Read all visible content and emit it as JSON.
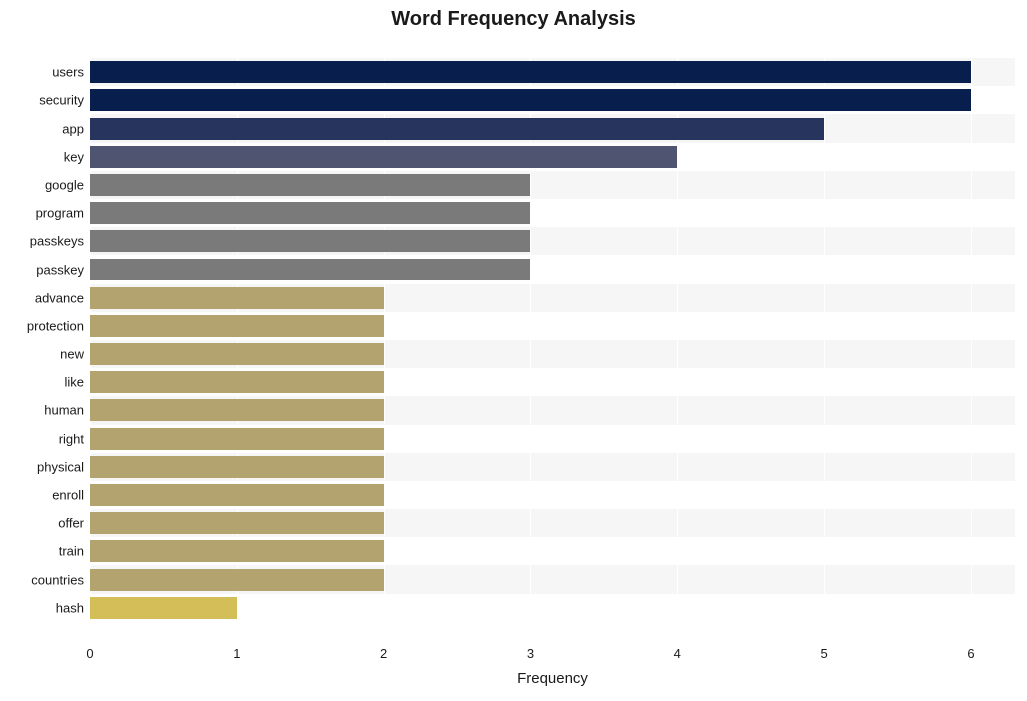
{
  "chart_data": {
    "type": "bar",
    "orientation": "horizontal",
    "title": "Word Frequency Analysis",
    "xlabel": "Frequency",
    "ylabel": "",
    "xlim": [
      0,
      6.3
    ],
    "xticks": [
      0,
      1,
      2,
      3,
      4,
      5,
      6
    ],
    "categories": [
      "users",
      "security",
      "app",
      "key",
      "google",
      "program",
      "passkeys",
      "passkey",
      "advance",
      "protection",
      "new",
      "like",
      "human",
      "right",
      "physical",
      "enroll",
      "offer",
      "train",
      "countries",
      "hash"
    ],
    "values": [
      6,
      6,
      5,
      4,
      3,
      3,
      3,
      3,
      2,
      2,
      2,
      2,
      2,
      2,
      2,
      2,
      2,
      2,
      2,
      1
    ],
    "colors": [
      "#081f4d",
      "#081f4d",
      "#26345e",
      "#4f5570",
      "#7a7a7a",
      "#7a7a7a",
      "#7a7a7a",
      "#7a7a7a",
      "#b2a36f",
      "#b2a36f",
      "#b2a36f",
      "#b2a36f",
      "#b2a36f",
      "#b2a36f",
      "#b2a36f",
      "#b2a36f",
      "#b2a36f",
      "#b2a36f",
      "#b2a36f",
      "#d3be58"
    ]
  }
}
